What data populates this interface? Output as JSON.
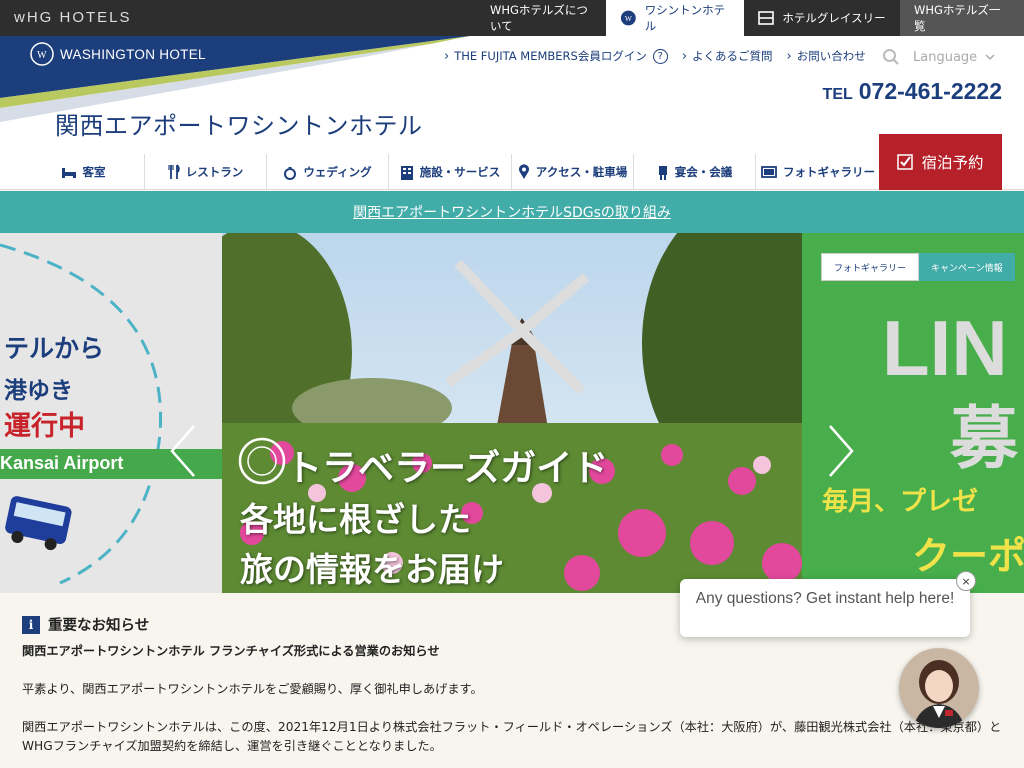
{
  "topbar": {
    "logo": "wHG HOTELS",
    "tabs": [
      "WHGホテルズについて",
      "ワシントンホテル",
      "ホテルグレイスリー",
      "WHGホテルズ一覧"
    ]
  },
  "header": {
    "brand": "WASHINGTON HOTEL",
    "links": [
      "THE FUJITA MEMBERS会員ログイン",
      "よくあるご質問",
      "お問い合わせ"
    ],
    "help_glyph": "?",
    "language": "Language",
    "tel_label": "TEL",
    "tel_number": "072-461-2222",
    "title": "関西エアポートワシントンホテル"
  },
  "nav": {
    "items": [
      {
        "label": "客室",
        "icon": "bed-icon"
      },
      {
        "label": "レストラン",
        "icon": "fork-knife-icon"
      },
      {
        "label": "ウェディング",
        "icon": "ring-icon"
      },
      {
        "label": "施設・サービス",
        "icon": "building-icon"
      },
      {
        "label": "アクセス・駐車場",
        "icon": "map-pin-icon"
      },
      {
        "label": "宴会・会議",
        "icon": "podium-icon"
      },
      {
        "label": "フォトギャラリー",
        "icon": "monitor-icon"
      }
    ],
    "reserve": "宿泊予約"
  },
  "sdgs": {
    "link": "関西エアポートワシントンホテルSDGsの取り組み"
  },
  "carousel": {
    "left": {
      "line1": "テルから",
      "line2": "港ゆき",
      "line3": "運行中",
      "band": "Kansai Airport"
    },
    "center": {
      "line1": "トラベラーズガイド",
      "line2": "各地に根ざした",
      "line3": "旅の情報をお届け"
    },
    "right": {
      "tab1": "フォトギャラリー",
      "tab2": "キャンペーン情報",
      "big1": "LIN",
      "big2": "募",
      "line1": "毎月、プレゼ",
      "line2": "クーポ"
    }
  },
  "notice": {
    "heading": "重要なお知らせ",
    "info_glyph": "i",
    "subject": "関西エアポートワシントンホテル フランチャイズ形式による営業のお知らせ",
    "para1": "平素より、関西エアポートワシントンホテルをご愛顧賜り、厚く御礼申しあげます。",
    "para2a": "関西エアポートワシントンホテルは、この度、2021年12月1日より株式会社フラット・フィールド・オペレーションズ（本社：大阪府）が、藤田観光株式会社（本社：東京都）と",
    "para2b": "WHGフランチャイズ加盟契約を締結し、運営を引き継ぐこととなりました。"
  },
  "chat": {
    "message": "Any questions? Get instant help here!",
    "close": "×"
  },
  "colors": {
    "navy": "#1c3e7c",
    "teal": "#42aca9",
    "red": "#b62029",
    "green": "#47ae4b"
  }
}
